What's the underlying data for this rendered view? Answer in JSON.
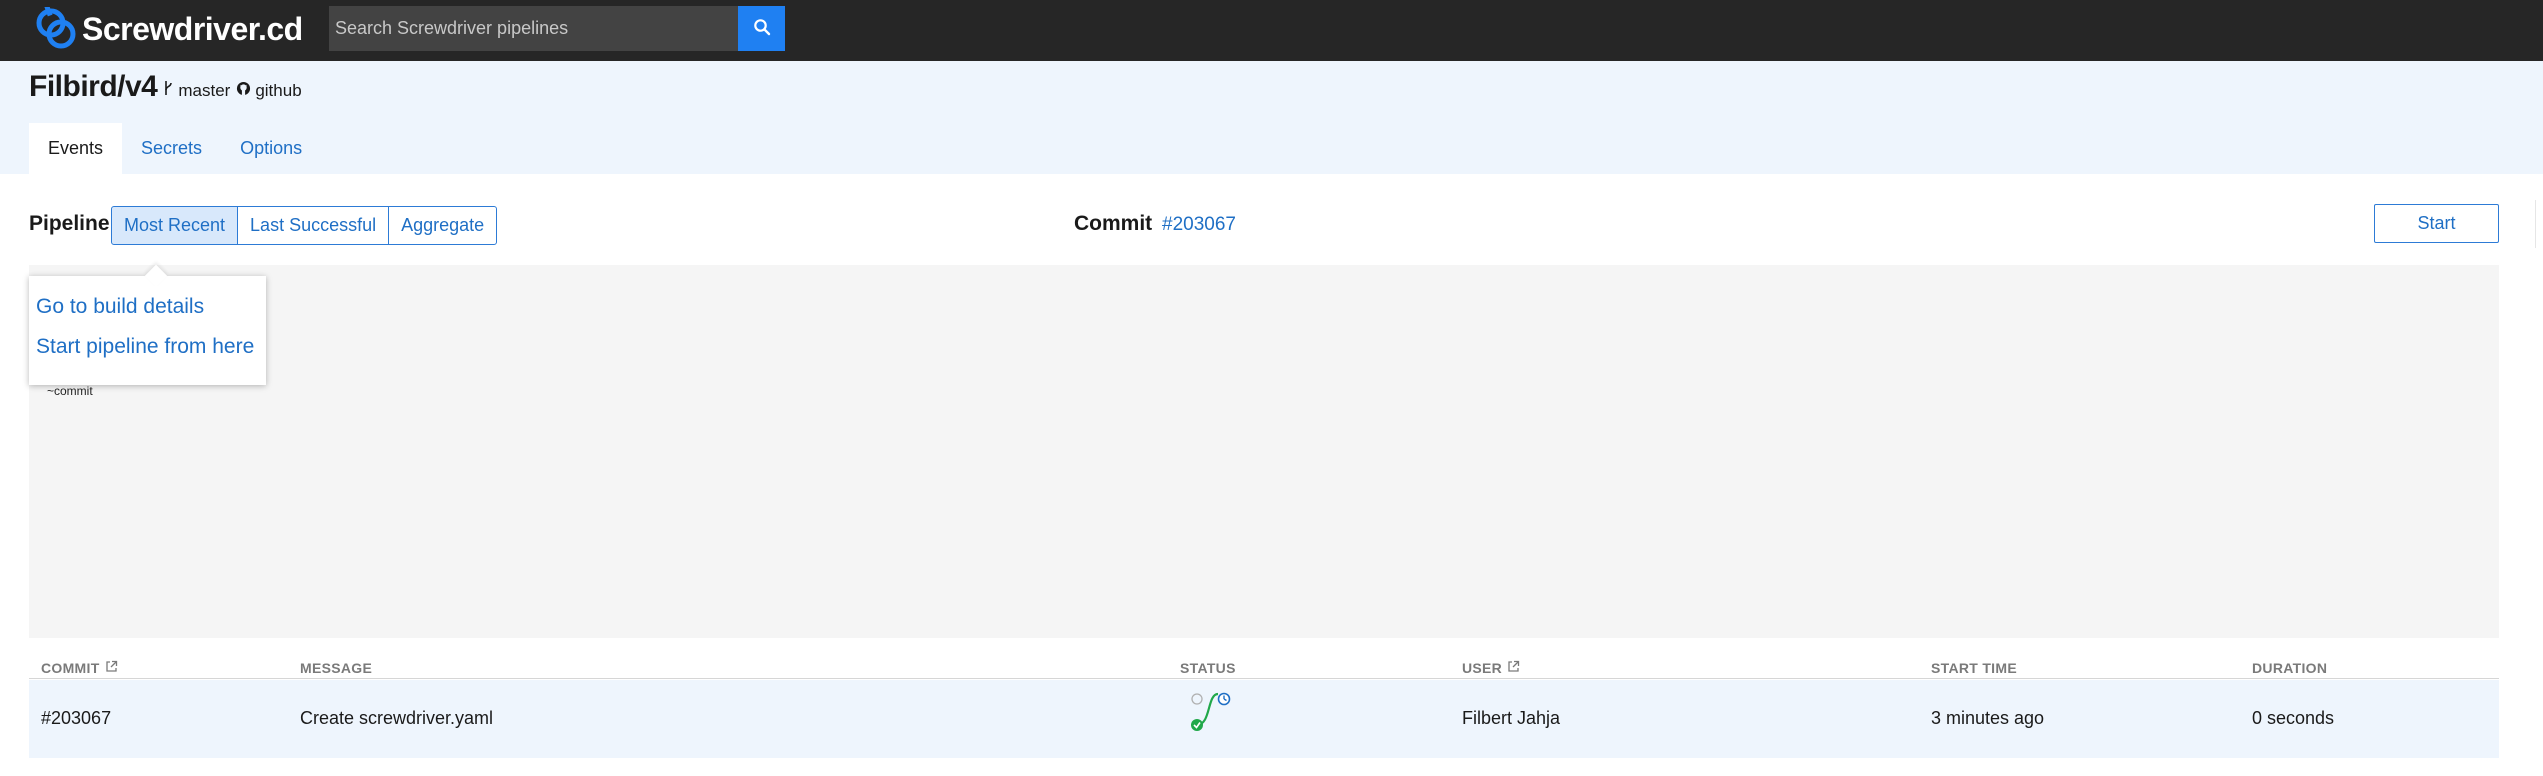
{
  "app": {
    "name": "Screwdriver.cd"
  },
  "search": {
    "placeholder": "Search Screwdriver pipelines"
  },
  "repo": {
    "name": "Filbird/v4",
    "branch": "master",
    "scm": "github"
  },
  "tabs": [
    {
      "label": "Events",
      "active": true
    },
    {
      "label": "Secrets",
      "active": false
    },
    {
      "label": "Options",
      "active": false
    }
  ],
  "pipeline": {
    "label": "Pipeline",
    "views": [
      {
        "label": "Most Recent",
        "active": true
      },
      {
        "label": "Last Successful",
        "active": false
      },
      {
        "label": "Aggregate",
        "active": false
      }
    ],
    "commit_label": "Commit",
    "commit_sha": "#203067",
    "start_label": "Start"
  },
  "graph": {
    "node_label": "~commit",
    "menu": [
      {
        "label": "Go to build details"
      },
      {
        "label": "Start pipeline from here"
      }
    ]
  },
  "events_table": {
    "columns": [
      "COMMIT",
      "MESSAGE",
      "STATUS",
      "USER",
      "START TIME",
      "DURATION"
    ],
    "rows": [
      {
        "commit": "#203067",
        "message": "Create screwdriver.yaml",
        "user": "Filbert Jahja",
        "start_time": "3 minutes ago",
        "duration": "0 seconds"
      }
    ]
  },
  "colors": {
    "topbar": "#262626",
    "accent": "#1f80f2",
    "link": "#1f6fc5",
    "success": "#21a84a",
    "running": "#1f6fc5",
    "header_bg": "#eef5fd"
  },
  "icons": [
    "screwdriver-logo-icon",
    "search-icon",
    "branch-icon",
    "github-icon",
    "external-link-icon",
    "success-icon",
    "running-icon",
    "pending-icon"
  ]
}
